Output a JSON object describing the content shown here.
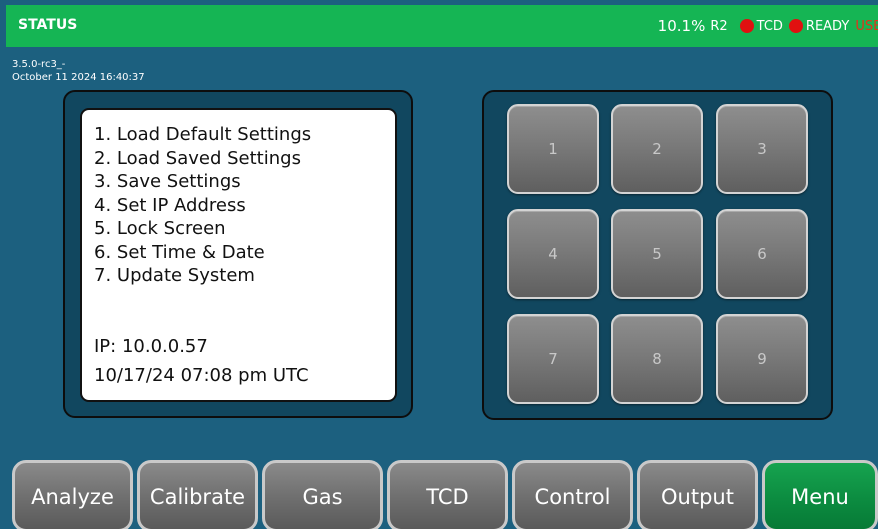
{
  "status": {
    "title": "STATUS",
    "percent": "10.1%",
    "range": "R2",
    "indicator_tcd": "TCD",
    "indicator_ready": "READY",
    "usb": "USB",
    "indicator_color": "#e11010",
    "bar_color": "#15b554"
  },
  "version": {
    "build": "3.5.0-rc3_-",
    "date": "October 11 2024 16:40:37"
  },
  "info": {
    "items": [
      "1. Load Default Settings",
      "2. Load Saved Settings",
      "3. Save Settings",
      "4. Set IP Address",
      "5. Lock Screen",
      "6. Set Time & Date",
      "7. Update System"
    ],
    "ip": "IP: 10.0.0.57",
    "datetime": "10/17/24 07:08 pm UTC"
  },
  "keypad": {
    "keys": [
      "1",
      "2",
      "3",
      "4",
      "5",
      "6",
      "7",
      "8",
      "9"
    ]
  },
  "tabs": [
    {
      "label": "Analyze",
      "active": false
    },
    {
      "label": "Calibrate",
      "active": false
    },
    {
      "label": "Gas",
      "active": false
    },
    {
      "label": "TCD",
      "active": false
    },
    {
      "label": "Control",
      "active": false
    },
    {
      "label": "Output",
      "active": false
    },
    {
      "label": "Menu",
      "active": true
    }
  ]
}
